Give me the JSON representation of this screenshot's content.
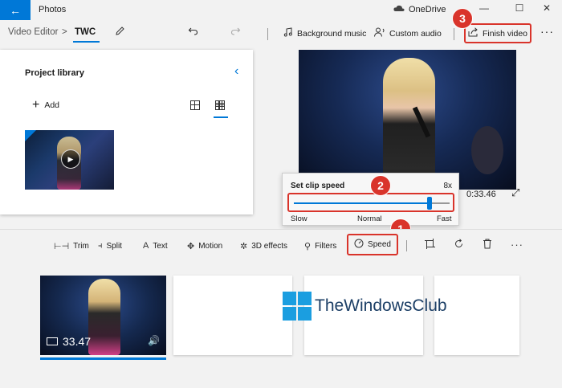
{
  "window": {
    "app_title": "Photos",
    "onedrive_label": "OneDrive",
    "back_glyph": "←",
    "minimize_glyph": "—",
    "maximize_glyph": "☐",
    "close_glyph": "✕"
  },
  "toolbar": {
    "breadcrumb_root": "Video Editor",
    "breadcrumb_sep": ">",
    "project_name": "TWC",
    "rename_icon": "pencil-icon",
    "undo_icon": "undo-icon",
    "redo_icon": "redo-icon",
    "background_music_label": "Background music",
    "custom_audio_label": "Custom audio",
    "finish_video_label": "Finish video",
    "more_label": "···"
  },
  "library": {
    "title": "Project library",
    "collapse_glyph": "‹",
    "add_label": "Add",
    "add_glyph": "+",
    "play_glyph": "▶"
  },
  "preview": {
    "time": "0:33.46",
    "expand_glyph": "⤢"
  },
  "speed_popup": {
    "title": "Set clip speed",
    "value": "8x",
    "slow_label": "Slow",
    "normal_label": "Normal",
    "fast_label": "Fast",
    "level_fraction": 0.87
  },
  "storyboard": {
    "trim_label": "Trim",
    "split_label": "Split",
    "text_label": "Text",
    "motion_label": "Motion",
    "effects_label": "3D effects",
    "filters_label": "Filters",
    "speed_label": "Speed",
    "more_label": "···",
    "clip_duration": "33.47",
    "volume_glyph": "🔊"
  },
  "badges": {
    "one": "1",
    "two": "2",
    "three": "3"
  },
  "watermark": {
    "text": "TheWindowsClub"
  },
  "colors": {
    "accent": "#0078d7",
    "highlight": "#d9342b"
  }
}
